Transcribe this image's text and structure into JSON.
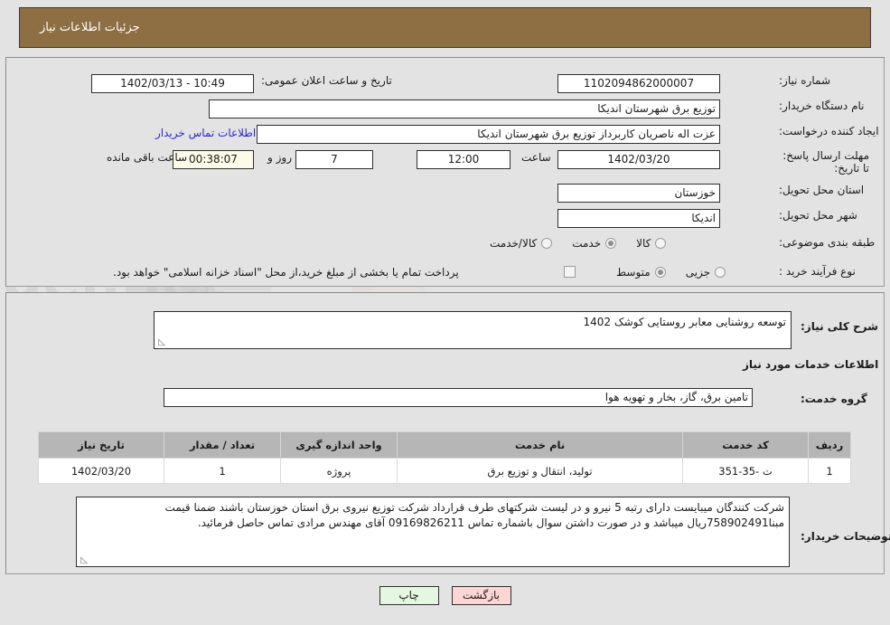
{
  "header": {
    "title": "جزئیات اطلاعات نیاز"
  },
  "form": {
    "need_number_label": "شماره نیاز:",
    "need_number_value": "1102094862000007",
    "announce_label": "تاریخ و ساعت اعلان عمومی:",
    "announce_value": "10:49 - 1402/03/13",
    "buyer_org_label": "نام دستگاه خریدار:",
    "buyer_org_value": "توزیع برق شهرستان اندیکا",
    "creator_label": "ایجاد کننده درخواست:",
    "creator_value": "عزت اله ناصریان کاربرداز توزیع برق شهرستان اندیکا",
    "contact_link": "اطلاعات تماس خریدار",
    "deadline_label": "مهلت ارسال پاسخ: تا تاریخ:",
    "deadline_date": "1402/03/20",
    "hour_label": "ساعت",
    "deadline_time": "12:00",
    "days_value": "7",
    "days_label": "روز و",
    "countdown_value": "00:38:07",
    "remaining_label": "ساعت باقی مانده",
    "province_label": "استان محل تحویل:",
    "province_value": "خوزستان",
    "city_label": "شهر محل تحویل:",
    "city_value": "اندیکا",
    "category_label": "طبقه بندی موضوعی:",
    "category_options": [
      {
        "label": "کالا",
        "selected": false
      },
      {
        "label": "خدمت",
        "selected": true
      },
      {
        "label": "کالا/خدمت",
        "selected": false
      }
    ],
    "process_label": "نوع فرآیند خرید :",
    "process_options": [
      {
        "label": "جزیی",
        "selected": false
      },
      {
        "label": "متوسط",
        "selected": true
      }
    ],
    "treasury_checkbox_label": "پرداخت تمام یا بخشی از مبلغ خرید،از محل \"اسناد خزانه اسلامی\" خواهد بود.",
    "treasury_checked": false
  },
  "main": {
    "summary_label": "شرح کلی نیاز:",
    "summary_value": "توسعه روشنایی معابر روستایی کوشک 1402",
    "services_heading": "اطلاعات خدمات مورد نیاز",
    "service_group_label": "گروه خدمت:",
    "service_group_value": "تامین برق، گاز، بخار و تهویه هوا",
    "notes_label": "توضیحات خریدار:",
    "notes_value": "شرکت کنندگان میبایست دارای رتبه 5 نیرو و در لیست شرکتهای طرف قرارداد شرکت توزیع نیروی برق استان خوزستان باشند ضمنا قیمت مبنا758902491ریال میباشد و در صورت داشتن سوال باشماره تماس 09169826211 آقای مهندس مرادی تماس حاصل فرمائید."
  },
  "table": {
    "columns": [
      "ردیف",
      "کد خدمت",
      "نام خدمت",
      "واحد اندازه گیری",
      "تعداد / مقدار",
      "تاریخ نیاز"
    ],
    "rows": [
      {
        "row": "1",
        "code": "ت -35-351",
        "name": "تولید، انتقال و توزیع برق",
        "unit": "پروژه",
        "qty": "1",
        "date": "1402/03/20"
      }
    ]
  },
  "buttons": {
    "print": "چاپ",
    "back": "بازگشت"
  },
  "colors": {
    "header_brown": "#8d6f43",
    "page_bg": "#e3e3e3",
    "table_header": "#b6b6b6",
    "link_blue": "#2a2ad0",
    "print_btn": "#e4f7e0",
    "back_btn": "#fcd5d5",
    "countdown_bg": "#fcfbe8"
  }
}
